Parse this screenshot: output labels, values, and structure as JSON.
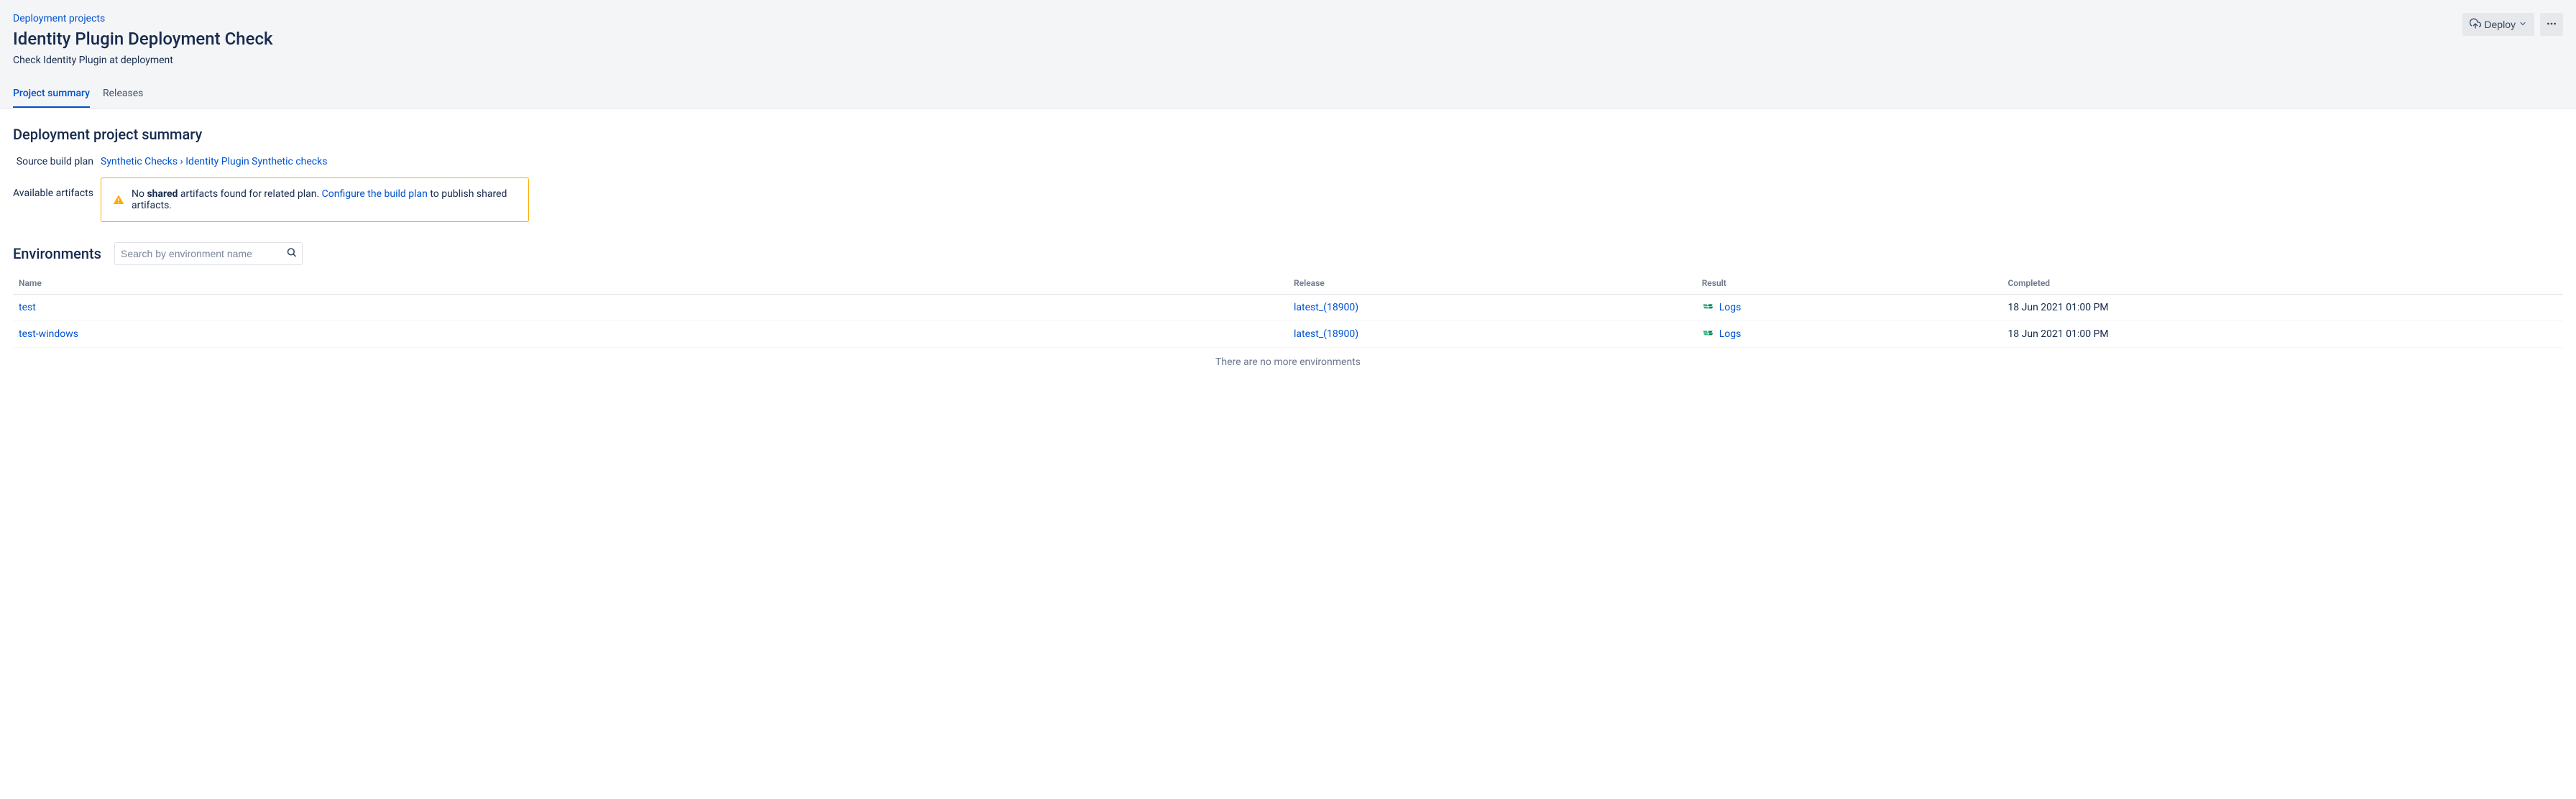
{
  "breadcrumb": "Deployment projects",
  "title": "Identity Plugin Deployment Check",
  "description": "Check Identity Plugin at deployment",
  "actions": {
    "deploy_label": "Deploy"
  },
  "tabs": {
    "project_summary": "Project summary",
    "releases": "Releases"
  },
  "summary": {
    "heading": "Deployment project summary",
    "source_plan_label": "Source build plan",
    "source_plan_prefix": "Synthetic Checks",
    "source_plan_sep": " › ",
    "source_plan_link": "Identity Plugin Synthetic checks",
    "artifacts_label": "Available artifacts",
    "warning_prefix": "No ",
    "warning_bold": "shared",
    "warning_mid": " artifacts found for related plan. ",
    "warning_link": "Configure the build plan",
    "warning_suffix": " to publish shared artifacts."
  },
  "environments": {
    "heading": "Environments",
    "search_placeholder": "Search by environment name",
    "columns": {
      "name": "Name",
      "release": "Release",
      "result": "Result",
      "completed": "Completed"
    },
    "rows": [
      {
        "name": "test",
        "release": "latest_(18900)",
        "result_label": "Logs",
        "completed": "18 Jun 2021 01:00 PM"
      },
      {
        "name": "test-windows",
        "release": "latest_(18900)",
        "result_label": "Logs",
        "completed": "18 Jun 2021 01:00 PM"
      }
    ],
    "no_more": "There are no more environments"
  }
}
